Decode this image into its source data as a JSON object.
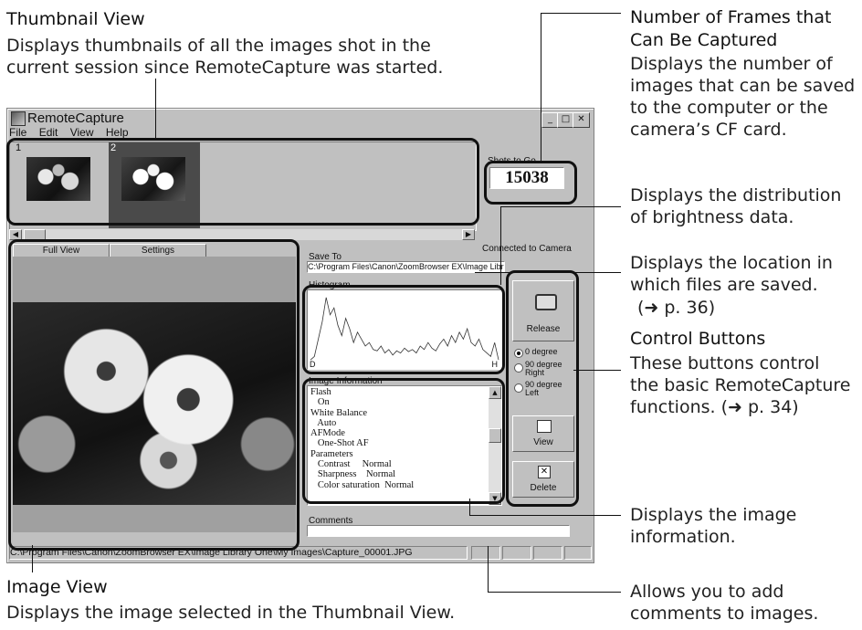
{
  "annotations": {
    "thumbnail_view": {
      "title": "Thumbnail View",
      "body": [
        "Displays thumbnails of all the images shot in the",
        "current session since RemoteCapture was started."
      ]
    },
    "frames": {
      "title": [
        "Number of Frames that",
        "Can Be Captured"
      ],
      "body": [
        "Displays the number of",
        "images that can be saved",
        "to the computer or the",
        "camera’s CF card."
      ]
    },
    "histogram": {
      "body": [
        "Displays the distribution",
        "of brightness data."
      ]
    },
    "save_location": {
      "body": [
        "Displays the location in",
        "which files are saved."
      ],
      "ref": "(➜ p. 36)"
    },
    "control_buttons": {
      "title": "Control Buttons",
      "body": [
        "These buttons control",
        "the basic RemoteCapture",
        "functions. (➜ p. 34)"
      ]
    },
    "image_info": {
      "body": [
        "Displays the image",
        "information."
      ]
    },
    "image_view": {
      "title": "Image View",
      "body": "Displays the image selected in the Thumbnail View."
    },
    "comments": {
      "body": [
        "Allows you to add",
        "comments to images."
      ]
    }
  },
  "window": {
    "title": "RemoteCapture",
    "menu": [
      "File",
      "Edit",
      "View",
      "Help"
    ],
    "thumbnails": [
      {
        "index": "1"
      },
      {
        "index": "2"
      }
    ],
    "shots_label": "Shots to Go",
    "shots_count": "15038",
    "connected": "Connected to Camera",
    "tabs": [
      "Full View",
      "Settings"
    ],
    "save_to_label": "Save To",
    "save_to_path": "C:\\Program Files\\Canon\\ZoomBrowser EX\\Image Library One\\",
    "histogram_label": "Histogram",
    "histogram_axis": [
      "D",
      "H"
    ],
    "image_info_label": "Image Information",
    "image_info_lines": [
      "Flash",
      "   On",
      "White Balance",
      "   Auto",
      "AFMode",
      "   One-Shot AF",
      "Parameters",
      "   Contrast     Normal",
      "   Sharpness    Normal",
      "   Color saturation  Normal"
    ],
    "release_label": "Release",
    "rotations": [
      {
        "label": "0 degree",
        "selected": true
      },
      {
        "label": "90 degree Right",
        "selected": false
      },
      {
        "label": "90 degree Left",
        "selected": false
      }
    ],
    "view_label": "View",
    "delete_label": "Delete",
    "comments_label": "Comments",
    "status_path": "C:\\Program Files\\Canon\\ZoomBrowser EX\\Image Library One\\My Images\\Capture_00001.JPG",
    "histogram_values": [
      0.05,
      0.1,
      0.35,
      0.6,
      0.95,
      0.7,
      0.8,
      0.55,
      0.4,
      0.65,
      0.5,
      0.3,
      0.45,
      0.35,
      0.25,
      0.3,
      0.2,
      0.18,
      0.25,
      0.15,
      0.2,
      0.12,
      0.18,
      0.15,
      0.22,
      0.17,
      0.2,
      0.15,
      0.25,
      0.2,
      0.3,
      0.22,
      0.18,
      0.28,
      0.35,
      0.25,
      0.4,
      0.3,
      0.45,
      0.35,
      0.5,
      0.3,
      0.25,
      0.35,
      0.2,
      0.15,
      0.1,
      0.3,
      0.05
    ]
  }
}
